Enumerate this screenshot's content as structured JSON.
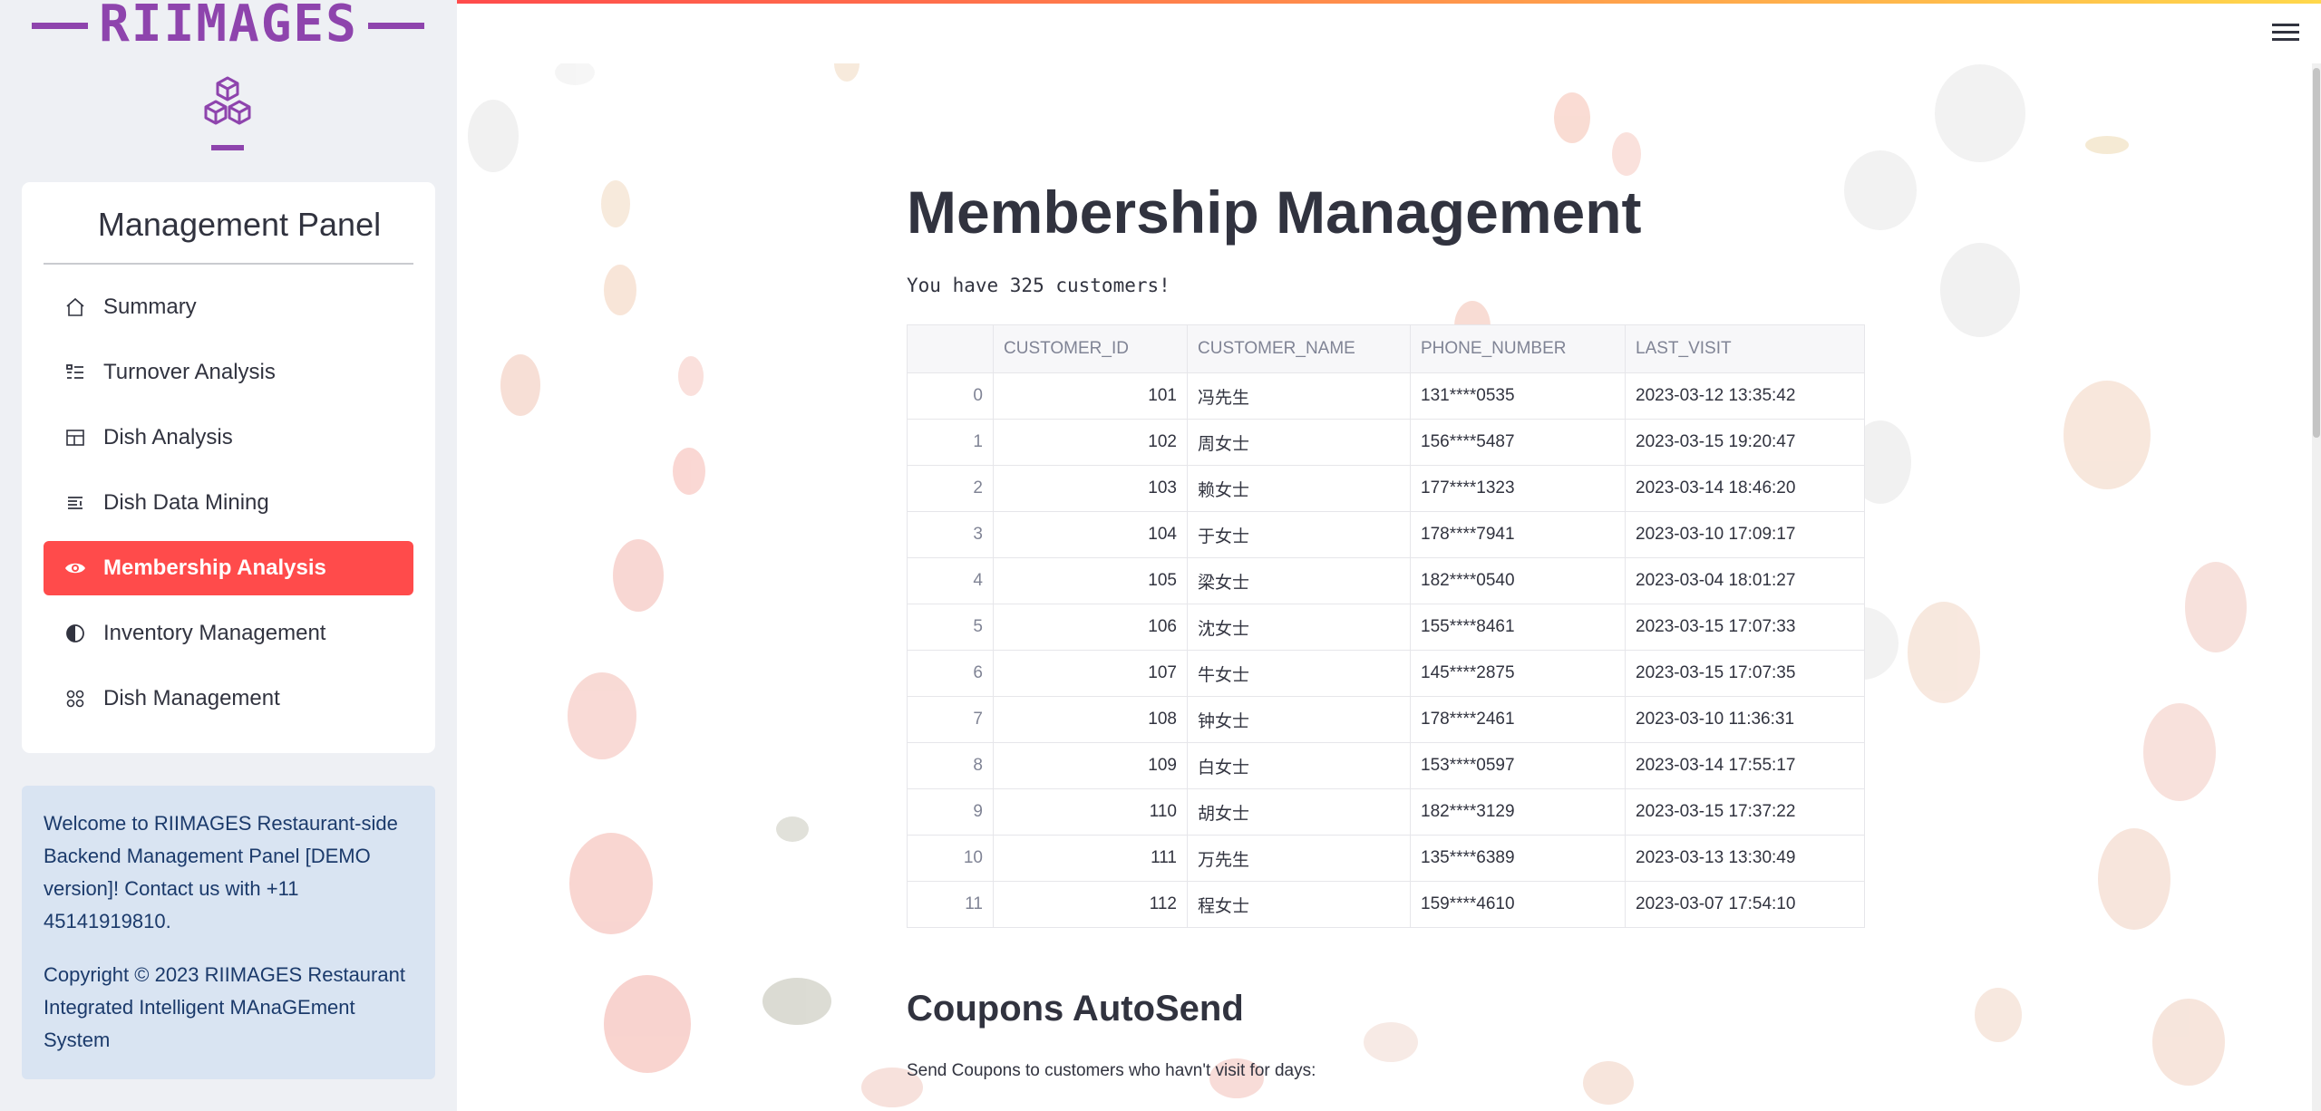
{
  "brand": {
    "name": "RIIMAGES",
    "logo_icon": "cubes-icon"
  },
  "sidebar": {
    "panel_title": "Management Panel",
    "items": [
      {
        "label": "Summary",
        "icon": "home-icon",
        "active": false
      },
      {
        "label": "Turnover Analysis",
        "icon": "list-icon",
        "active": false
      },
      {
        "label": "Dish Analysis",
        "icon": "layout-icon",
        "active": false
      },
      {
        "label": "Dish Data Mining",
        "icon": "text-icon",
        "active": false
      },
      {
        "label": "Membership Analysis",
        "icon": "eye-icon",
        "active": true
      },
      {
        "label": "Inventory Management",
        "icon": "half-circle-icon",
        "active": false
      },
      {
        "label": "Dish Management",
        "icon": "grid-dots-icon",
        "active": false
      }
    ],
    "info": {
      "welcome": "Welcome to RIIMAGES Restaurant-side Backend Management Panel [DEMO version]! Contact us with +11 45141919810.",
      "copyright": "Copyright © 2023 RIIMAGES Restaurant Integrated Intelligent MAnaGEment System"
    }
  },
  "header": {
    "menu_icon": "hamburger-icon"
  },
  "main": {
    "title": "Membership Management",
    "subtitle": "You have 325 customers!",
    "table": {
      "columns": [
        "",
        "CUSTOMER_ID",
        "CUSTOMER_NAME",
        "PHONE_NUMBER",
        "LAST_VISIT"
      ],
      "rows": [
        [
          "0",
          "101",
          "冯先生",
          "131****0535",
          "2023-03-12 13:35:42"
        ],
        [
          "1",
          "102",
          "周女士",
          "156****5487",
          "2023-03-15 19:20:47"
        ],
        [
          "2",
          "103",
          "赖女士",
          "177****1323",
          "2023-03-14 18:46:20"
        ],
        [
          "3",
          "104",
          "于女士",
          "178****7941",
          "2023-03-10 17:09:17"
        ],
        [
          "4",
          "105",
          "梁女士",
          "182****0540",
          "2023-03-04 18:01:27"
        ],
        [
          "5",
          "106",
          "沈女士",
          "155****8461",
          "2023-03-15 17:07:33"
        ],
        [
          "6",
          "107",
          "牛女士",
          "145****2875",
          "2023-03-15 17:07:35"
        ],
        [
          "7",
          "108",
          "钟女士",
          "178****2461",
          "2023-03-10 11:36:31"
        ],
        [
          "8",
          "109",
          "白女士",
          "153****0597",
          "2023-03-14 17:55:17"
        ],
        [
          "9",
          "110",
          "胡女士",
          "182****3129",
          "2023-03-15 17:37:22"
        ],
        [
          "10",
          "111",
          "万先生",
          "135****6389",
          "2023-03-13 13:30:49"
        ],
        [
          "11",
          "112",
          "程女士",
          "159****4610",
          "2023-03-07 17:54:10"
        ]
      ]
    },
    "coupons_title": "Coupons AutoSend",
    "coupons_text": "Send Coupons to customers who havn't visit for days:"
  },
  "colors": {
    "accent": "#ff4b4b",
    "brand": "#8e44ad",
    "info_bg": "#d9e4f2",
    "sidebar_bg": "#eef0f4"
  }
}
